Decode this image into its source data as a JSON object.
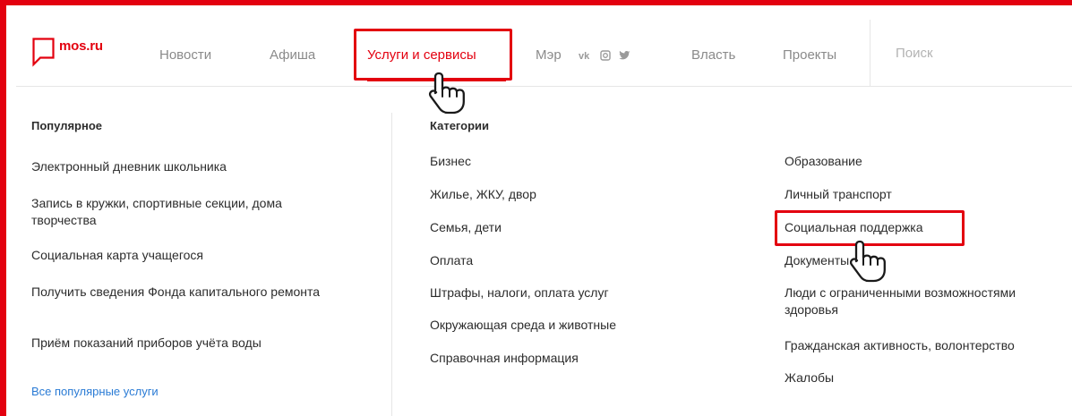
{
  "header": {
    "logo_text": "mos.ru",
    "nav": [
      {
        "label": "Новости",
        "active": false
      },
      {
        "label": "Афиша",
        "active": false
      },
      {
        "label": "Услуги и сервисы",
        "active": true
      },
      {
        "label": "Мэр",
        "active": false
      },
      {
        "label": "Власть",
        "active": false
      },
      {
        "label": "Проекты",
        "active": false
      }
    ],
    "socials": [
      "vk-icon",
      "instagram-icon",
      "twitter-icon"
    ],
    "search": {
      "placeholder": "Поиск",
      "value": ""
    }
  },
  "popular": {
    "heading": "Популярное",
    "items": [
      "Электронный дневник школьника",
      "Запись в кружки, спортивные секции, дома творчества",
      "Социальная карта учащегося",
      "Получить сведения Фонда капитального ремонта",
      "Приём показаний приборов учёта воды"
    ],
    "all_link": "Все популярные услуги"
  },
  "categories": {
    "heading": "Категории",
    "col1": [
      "Бизнес",
      "Жилье, ЖКУ, двор",
      "Семья, дети",
      "Оплата",
      "Штрафы, налоги, оплата услуг",
      "Окружающая среда и животные",
      "Справочная информация"
    ],
    "col2": [
      "Образование",
      "Личный транспорт",
      "Социальная поддержка",
      "Документы",
      "Люди с ограниченными возможностями здоровья",
      "Гражданская активность, волонтерство",
      "Жалобы"
    ]
  },
  "colors": {
    "accent": "#e3000f",
    "link": "#2a7bd5",
    "nav": "#8a8a8a",
    "text": "#2c2c2c"
  },
  "annotations": {
    "highlighted": [
      "Услуги и сервисы",
      "Социальная поддержка"
    ],
    "cursor_icon": "hand-pointer-icon"
  }
}
